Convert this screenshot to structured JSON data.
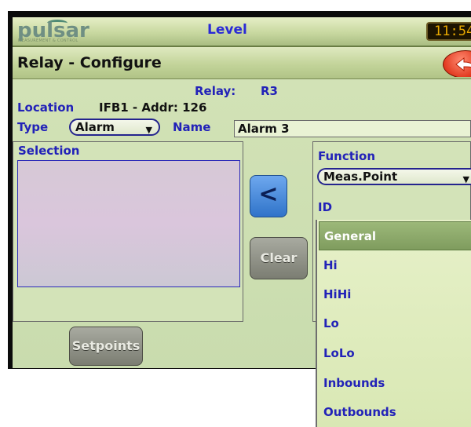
{
  "header": {
    "logo_text": "pulsar",
    "logo_tagline": "MEASUREMENT & CONTROL",
    "title": "Level",
    "clock": "11:54"
  },
  "page": {
    "title": "Relay - Configure"
  },
  "relay": {
    "label": "Relay:",
    "value": "R3",
    "location_label": "Location",
    "location_value": "IFB1 - Addr: 126",
    "type_label": "Type",
    "type_value": "Alarm",
    "name_label": "Name",
    "name_value": "Alarm 3"
  },
  "selection": {
    "label": "Selection"
  },
  "buttons": {
    "move_left": "<",
    "clear": "Clear",
    "setpoints": "Setpoints"
  },
  "function": {
    "label": "Function",
    "value": "Meas.Point",
    "id_label": "ID"
  },
  "id_options": [
    "General",
    "Hi",
    "HiHi",
    "Lo",
    "LoLo",
    "Inbounds",
    "Outbounds"
  ],
  "colors": {
    "bar_green": "#c8d8a0",
    "text_blue": "#2222b8",
    "selected_option": "#8daa6b",
    "button_blue": "#3a7fd0"
  }
}
